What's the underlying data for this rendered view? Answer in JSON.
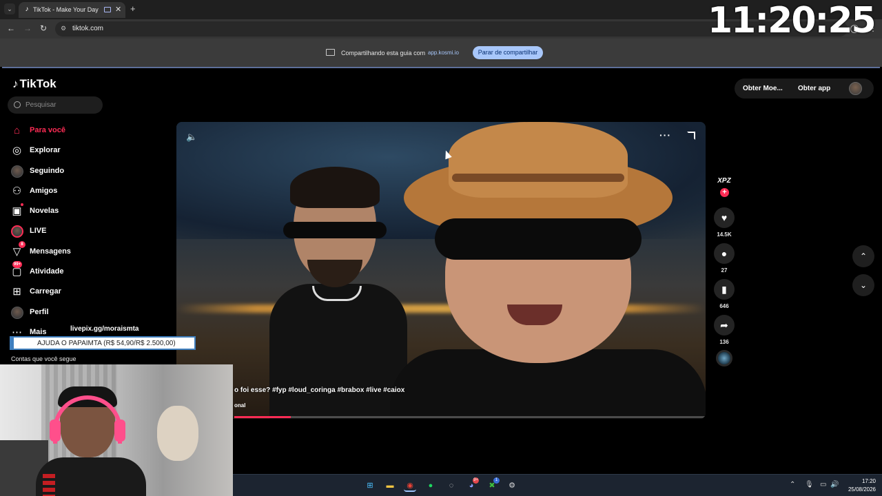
{
  "browser": {
    "tab_title": "TikTok - Make Your Day",
    "url": "tiktok.com"
  },
  "share_bar": {
    "text": "Compartilhando esta guia com",
    "domain": "app.kosmi.io",
    "stop_button": "Parar de compartilhar"
  },
  "overlay": {
    "clock": "11:20:25",
    "donation_url": "livepix.gg/moraismta",
    "donation_text": "AJUDA O PAPAIMTA (R$ 54,90/R$ 2.500,00)"
  },
  "tiktok": {
    "logo": "TikTok",
    "search_placeholder": "Pesquisar",
    "nav": [
      {
        "label": "Para você",
        "icon": "home-icon"
      },
      {
        "label": "Explorar",
        "icon": "compass-icon"
      },
      {
        "label": "Seguindo",
        "icon": "following-avatar-icon"
      },
      {
        "label": "Amigos",
        "icon": "friends-icon"
      },
      {
        "label": "Novelas",
        "icon": "novelas-icon"
      },
      {
        "label": "LIVE",
        "icon": "live-icon"
      },
      {
        "label": "Mensagens",
        "icon": "messages-icon",
        "badge": "8"
      },
      {
        "label": "Atividade",
        "icon": "activity-icon",
        "badge": "99+"
      },
      {
        "label": "Carregar",
        "icon": "upload-icon"
      },
      {
        "label": "Perfil",
        "icon": "profile-avatar-icon"
      },
      {
        "label": "Mais",
        "icon": "more-icon"
      }
    ],
    "following_accounts_label": "Contas que você segue",
    "header": {
      "coins": "Obter Moe...",
      "app": "Obter app"
    },
    "video": {
      "caption": "o foi esse? #fyp #loud_coringa #brabox #live #caiox",
      "music": "onal",
      "progress": 0.12
    },
    "creator_badge": "XPZ",
    "stats": {
      "likes": "14.5K",
      "comments": "27",
      "saves": "646",
      "shares": "136"
    }
  },
  "taskbar": {
    "time": "17:20",
    "date": "25/08/2026",
    "discord_badge": "9+",
    "xbox_badge": "1"
  },
  "colors": {
    "accent": "#fe2c55",
    "share_button": "#a8c7fa"
  }
}
